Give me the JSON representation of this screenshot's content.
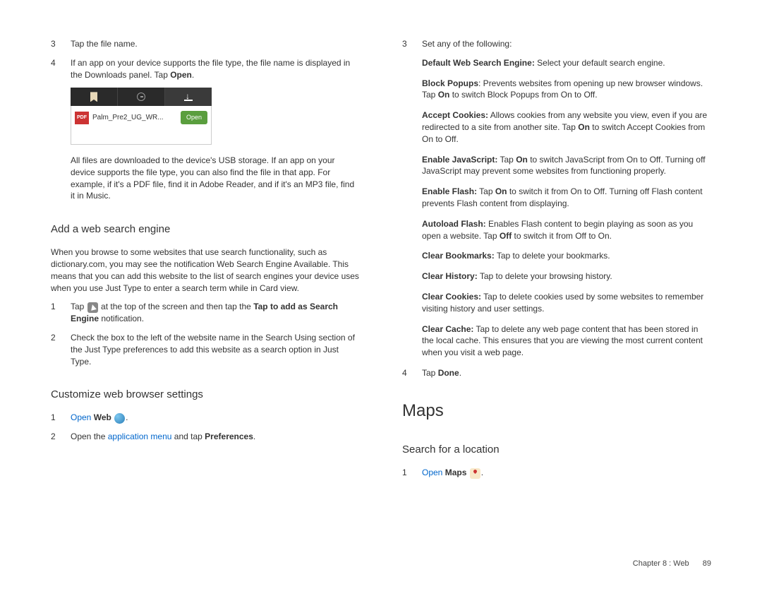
{
  "col1": {
    "step3": {
      "num": "3",
      "text": "Tap the file name."
    },
    "step4": {
      "num": "4",
      "text_a": "If an app on your device supports the file type, the file name is displayed in the Downloads panel. Tap ",
      "bold": "Open",
      "text_b": "."
    },
    "screenshot": {
      "pdf_label": "PDF",
      "filename": "Palm_Pre2_UG_WR...",
      "open_btn": "Open"
    },
    "after_ss": "All files are downloaded to the device's USB storage. If an app on your device supports the file type, you can also find the file in that app. For example, if it's a PDF file, find it in Adobe Reader, and if it's an MP3 file, find it in Music.",
    "heading_add": "Add a web search engine",
    "add_intro": "When you browse to some websites that use search functionality, such as dictionary.com, you may see the notification Web Search Engine Available. This means that you can add this website to the list of search engines your device uses when you use Just Type to enter a search term while in Card view.",
    "add1": {
      "num": "1",
      "text_a": "Tap ",
      "text_b": " at the top of the screen and then tap the ",
      "bold1": "Tap to add as Search Engine",
      "text_c": " notification."
    },
    "add2": {
      "num": "2",
      "text": "Check the box to the left of the website name in the Search Using section of the Just Type preferences to add this website as a search option in Just Type."
    },
    "heading_custom": "Customize web browser settings",
    "cust1": {
      "num": "1",
      "link": "Open",
      "bold": "Web",
      "dot": "."
    },
    "cust2": {
      "num": "2",
      "text_a": "Open the ",
      "link": "application menu",
      "text_b": " and tap ",
      "bold": "Preferences",
      "text_c": "."
    }
  },
  "col2": {
    "step3": {
      "num": "3",
      "text": "Set any of the following:"
    },
    "settings": {
      "default_label": "Default Web Search Engine:",
      "default_text": " Select your default search engine.",
      "block_label": "Block Popups",
      "block_a": ": Prevents websites from opening up new browser windows. Tap ",
      "block_on": "On",
      "block_b": " to switch Block Popups from On to Off.",
      "cookies_label": "Accept Cookies:",
      "cookies_a": " Allows cookies from any website you view, even if you are redirected to a site from another site. Tap ",
      "cookies_on": "On",
      "cookies_b": " to switch Accept Cookies from On to Off.",
      "js_label": "Enable JavaScript:",
      "js_a": " Tap ",
      "js_on": "On",
      "js_b": " to switch JavaScript from On to Off. Turning off JavaScript may prevent some websites from functioning properly.",
      "flash_label": "Enable Flash:",
      "flash_a": " Tap ",
      "flash_on": "On",
      "flash_b": " to switch it from On to Off. Turning off Flash content prevents Flash content from displaying.",
      "auto_label": "Autoload Flash:",
      "auto_a": " Enables Flash content to begin playing as soon as you open a website. Tap ",
      "auto_off": "Off",
      "auto_b": " to switch it from Off to On.",
      "bookmarks_label": "Clear Bookmarks:",
      "bookmarks_text": " Tap to delete your bookmarks.",
      "history_label": "Clear History:",
      "history_text": " Tap to delete your browsing history.",
      "clearcookies_label": "Clear Cookies:",
      "clearcookies_text": " Tap to delete cookies used by some websites to remember visiting history and user settings.",
      "cache_label": "Clear Cache:",
      "cache_text": " Tap to delete any web page content that has been stored in the local cache. This ensures that you are viewing the most current content when you visit a web page."
    },
    "step4": {
      "num": "4",
      "text_a": "Tap ",
      "bold": "Done",
      "text_b": "."
    },
    "heading_maps": "Maps",
    "heading_search": "Search for a location",
    "maps1": {
      "num": "1",
      "link": "Open",
      "bold": "Maps",
      "dot": "."
    }
  },
  "footer": {
    "chapter": "Chapter 8 : Web",
    "page": "89"
  }
}
